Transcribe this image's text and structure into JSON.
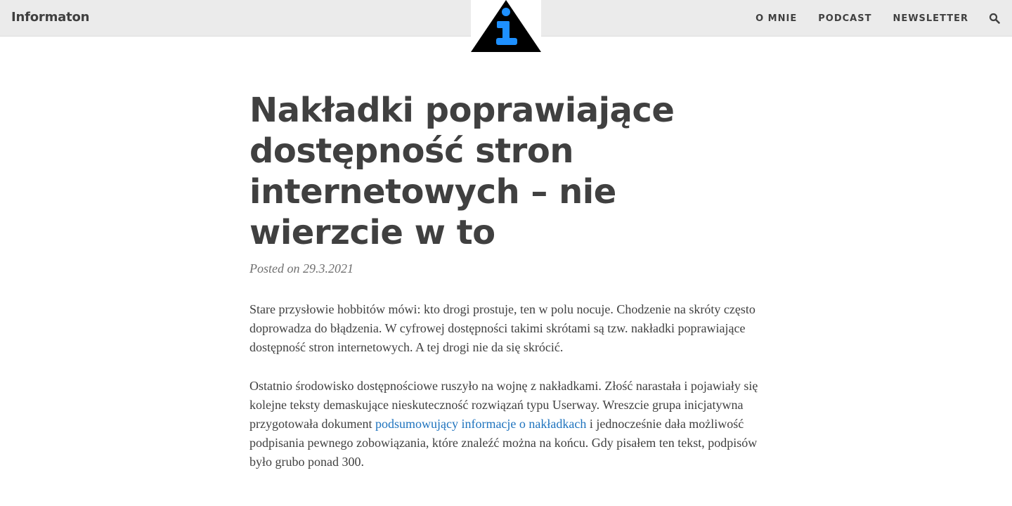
{
  "site": {
    "brand": "Informaton"
  },
  "nav": {
    "items": [
      "O MNIE",
      "PODCAST",
      "NEWSLETTER"
    ],
    "search_icon": "search-icon"
  },
  "logo": {
    "icon": "info-triangle-logo",
    "colors": {
      "triangle": "#000000",
      "letter": "#1e90ff"
    }
  },
  "article": {
    "title": "Nakładki poprawiające dostępność stron internetowych – nie wierzcie w to",
    "meta": "Posted on 29.3.2021",
    "p1": "Stare przysłowie hobbitów mówi: kto drogi prostuje, ten w polu nocuje. Chodzenie na skróty często doprowadza do błądzenia. W cyfrowej dostępności takimi skrótami są tzw. nakładki poprawiające dostępność stron internetowych. A tej drogi nie da się skrócić.",
    "p2_before": "Ostatnio środowisko dostępnościowe ruszyło na wojnę z nakładkami. Złość narastała i pojawiały się kolejne teksty demaskujące nieskuteczność rozwiązań typu Userway. Wreszcie grupa inicjatywna przygotowała dokument ",
    "p2_link": "podsumowujący informacje o nakładkach",
    "p2_after": " i jednocześnie dała możliwość podpisania pewnego zobowiązania, które znaleźć można na końcu. Gdy pisałem ten tekst, podpisów było grubo ponad 300."
  },
  "colors": {
    "link": "#1e73be",
    "text": "#404040",
    "topbar": "#ebebeb"
  }
}
